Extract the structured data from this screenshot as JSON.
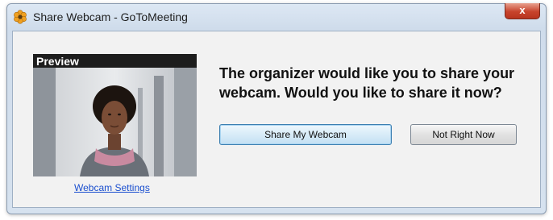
{
  "window": {
    "title": "Share Webcam - GoToMeeting",
    "close_label": "x"
  },
  "preview": {
    "label": "Preview",
    "settings_link": "Webcam Settings"
  },
  "message": "The organizer would like you to share your webcam. Would you like to share it now?",
  "buttons": {
    "share": "Share My Webcam",
    "not_now": "Not Right Now"
  },
  "colors": {
    "accent": "#3c7fb1",
    "link": "#1a4fcf",
    "close": "#c7432c"
  },
  "icons": {
    "app": "gotomeeting-flower-icon",
    "close": "close-icon"
  }
}
